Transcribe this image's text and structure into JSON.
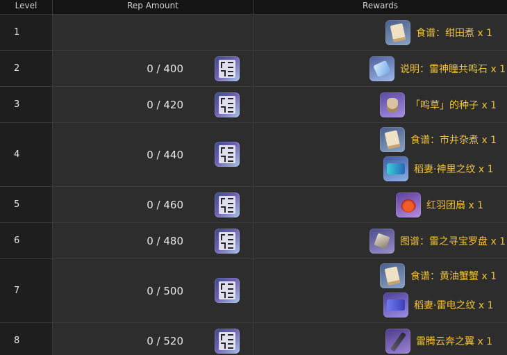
{
  "header": {
    "level": "Level",
    "rep_amount": "Rep Amount",
    "rewards": "Rewards"
  },
  "rows": [
    {
      "level": "1",
      "rep": "",
      "rewards": [
        {
          "text": "食谱：绀田煮 x 1",
          "icon": "recipe-icon"
        }
      ]
    },
    {
      "level": "2",
      "rep": "0 / 400",
      "rewards": [
        {
          "text": "说明：雷神瞳共鸣石 x 1",
          "icon": "item-icon"
        }
      ]
    },
    {
      "level": "3",
      "rep": "0 / 420",
      "rewards": [
        {
          "text": "「鸣草」的种子 x 1",
          "icon": "seed-bag-icon"
        }
      ]
    },
    {
      "level": "4",
      "rep": "0 / 440",
      "rewards": [
        {
          "text": "食谱：市井杂煮 x 1",
          "icon": "recipe-icon"
        },
        {
          "text": "稻妻·神里之纹 x 1",
          "icon": "namecard-icon"
        }
      ]
    },
    {
      "level": "5",
      "rep": "0 / 460",
      "rewards": [
        {
          "text": "红羽团扇 x 1",
          "icon": "fan-icon"
        }
      ]
    },
    {
      "level": "6",
      "rep": "0 / 480",
      "rewards": [
        {
          "text": "图谱：雷之寻宝罗盘 x 1",
          "icon": "compass-icon"
        }
      ]
    },
    {
      "level": "7",
      "rep": "0 / 500",
      "rewards": [
        {
          "text": "食谱：黄油蟹蟹 x 1",
          "icon": "recipe-icon"
        },
        {
          "text": "稻妻·雷电之纹 x 1",
          "icon": "namecard-icon"
        }
      ]
    },
    {
      "level": "8",
      "rep": "0 / 520",
      "rewards": [
        {
          "text": "雷腾云奔之翼 x 1",
          "icon": "wing-glider-icon"
        }
      ]
    }
  ],
  "rep_icon": "reputation-icon",
  "colors": {
    "reward_text": "#f0c239",
    "row_bg": "#2d2d2d",
    "level_bg": "#1e1e1e"
  }
}
